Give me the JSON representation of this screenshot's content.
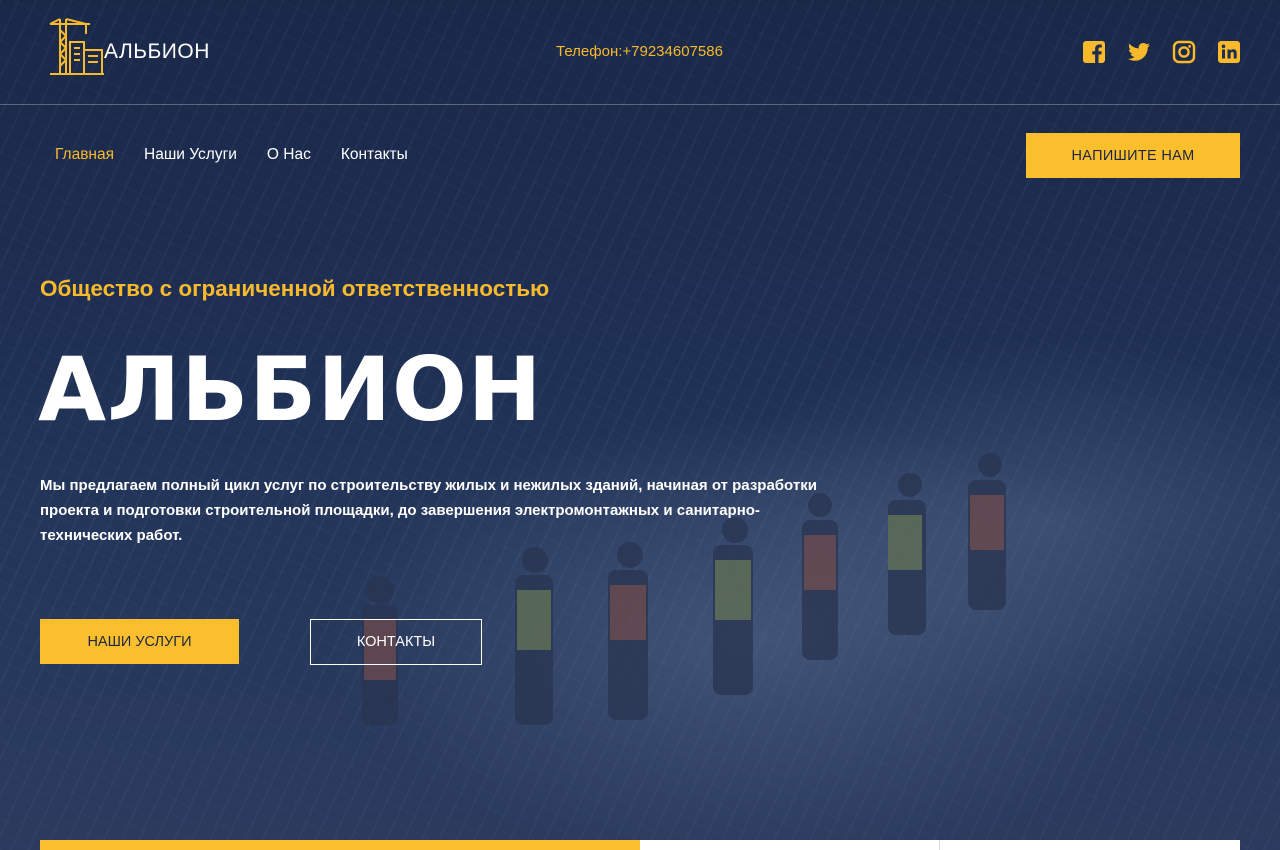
{
  "brand": {
    "logo_text": "АЛЬБИОН"
  },
  "header": {
    "phone": "Телефон:+79234607586"
  },
  "socials": [
    "facebook-icon",
    "twitter-icon",
    "instagram-icon",
    "linkedin-icon"
  ],
  "nav": {
    "items": [
      {
        "label": "Главная",
        "active": true
      },
      {
        "label": "Наши Услуги",
        "active": false
      },
      {
        "label": "О Нас",
        "active": false
      },
      {
        "label": "Контакты",
        "active": false
      }
    ],
    "cta_label": "НАПИШИТЕ НАМ"
  },
  "hero": {
    "subtitle": "Общество с ограниченной ответственностью",
    "title": "АЛЬБИОН",
    "description": "Мы предлагаем полный цикл услуг по строительству жилых и нежилых зданий, начиная от разработки проекта и подготовки строительной площадки, до завершения электромонтажных и санитарно-технических работ.",
    "primary_button": "НАШИ УСЛУГИ",
    "secondary_button": "КОНТАКТЫ"
  },
  "colors": {
    "accent": "#fbbf2e",
    "overlay": "#1c2b4a",
    "text": "#ffffff"
  }
}
